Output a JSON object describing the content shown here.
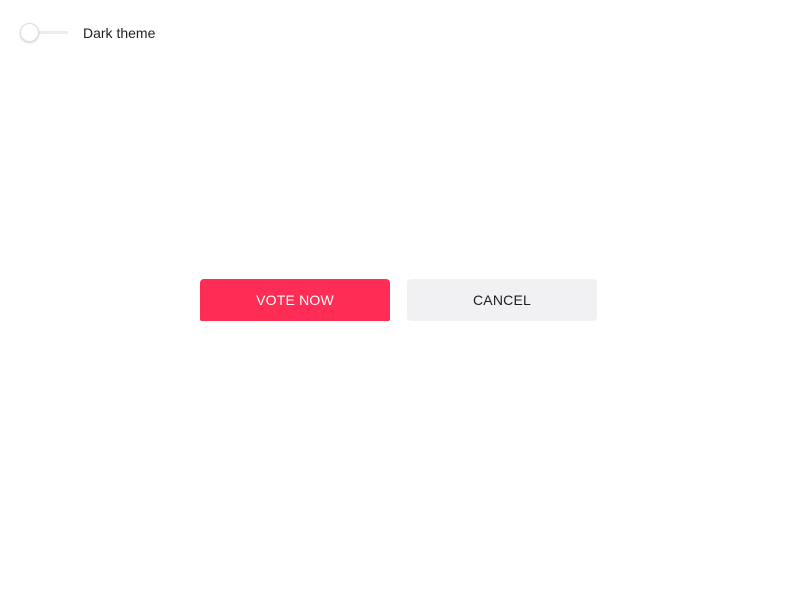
{
  "theme_toggle": {
    "label": "Dark theme",
    "checked": false
  },
  "actions": {
    "primary_label": "VOTE NOW",
    "secondary_label": "CANCEL"
  },
  "colors": {
    "primary": "#ff2d55",
    "secondary_bg": "#f1f1f3",
    "text": "#1c1c1e"
  }
}
